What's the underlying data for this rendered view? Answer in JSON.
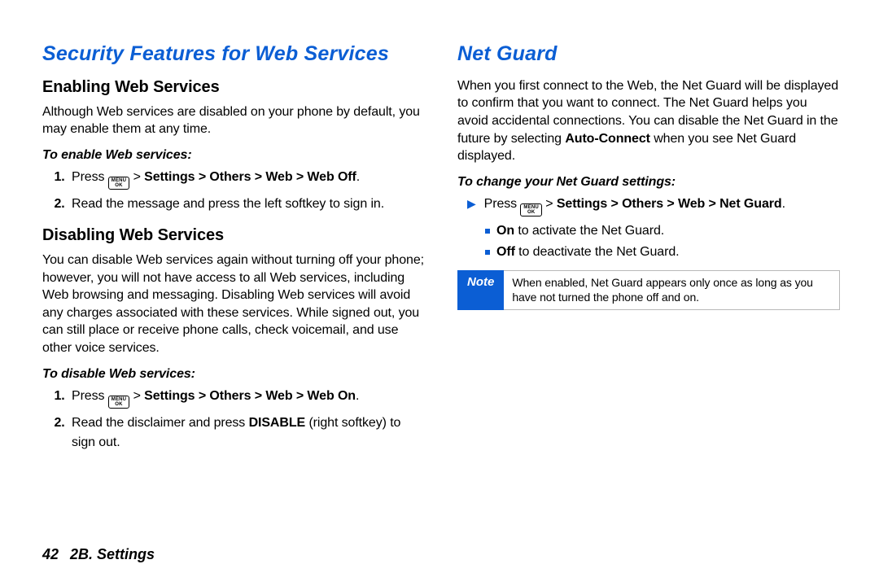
{
  "left": {
    "h1": "Security Features for Web Services",
    "enable": {
      "title": "Enabling Web Services",
      "para": "Although Web services are disabled on your phone by default, you may enable them at any time.",
      "subhead": "To enable Web services:",
      "step1_a": "Press ",
      "step1_b": " > ",
      "step1_c": "Settings > Others > Web > Web Off",
      "step1_d": ".",
      "step2": "Read the message and press the left softkey to sign in."
    },
    "disable": {
      "title": "Disabling Web Services",
      "para": "You can disable Web services again without turning off your phone; however, you will not have access to all Web services, including Web browsing and messaging. Disabling Web services will avoid any charges associated with these services. While signed out, you can still place or receive phone calls, check voicemail, and use other voice services.",
      "subhead": "To disable Web services:",
      "step1_a": "Press ",
      "step1_b": " > ",
      "step1_c": "Settings > Others > Web > Web On",
      "step1_d": ".",
      "step2_a": "Read the disclaimer and press ",
      "step2_b": "DISABLE",
      "step2_c": " (right softkey) to sign out."
    }
  },
  "right": {
    "h1": "Net Guard",
    "para_a": "When you first connect to the Web, the Net Guard will be displayed to confirm that you want to connect. The Net Guard helps you avoid accidental connections. You can disable the Net Guard in the future by selecting ",
    "para_b": "Auto-Connect",
    "para_c": " when you see Net Guard displayed.",
    "subhead": "To change your Net Guard settings:",
    "arrow_a": "Press ",
    "arrow_b": " > ",
    "arrow_c": "Settings > Others > Web > Net Guard",
    "arrow_d": ".",
    "opt_on_a": "On",
    "opt_on_b": " to activate the Net Guard.",
    "opt_off_a": "Off",
    "opt_off_b": " to deactivate the Net Guard.",
    "note_label": "Note",
    "note_text": "When enabled, Net Guard appears only once as long as you have not turned the phone off and on."
  },
  "footer": {
    "page": "42",
    "section": "2B. Settings"
  },
  "key": {
    "top": "MENU",
    "bottom": "OK"
  }
}
